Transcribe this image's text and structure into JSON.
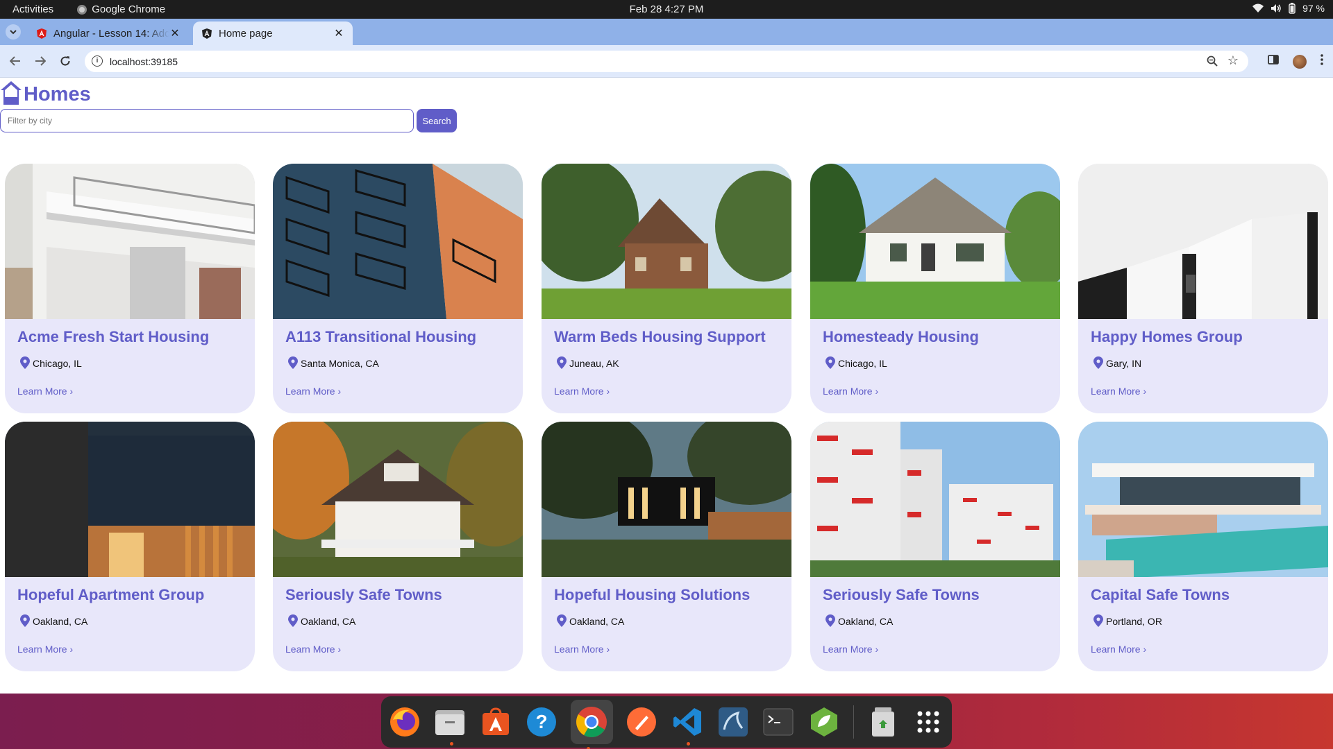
{
  "system_bar": {
    "activities": "Activities",
    "app_name": "Google Chrome",
    "clock": "Feb 28  4:27 PM",
    "battery": "97 %"
  },
  "browser": {
    "tabs": [
      {
        "title": "Angular - Lesson 14: Add",
        "icon": "angular-red-icon"
      },
      {
        "title": "Home page",
        "icon": "angular-dark-icon"
      }
    ],
    "url": "localhost:39185"
  },
  "app": {
    "brand": "Homes",
    "filter_placeholder": "Filter by city",
    "search_label": "Search",
    "learn_more": "Learn More ›",
    "listings": [
      {
        "name": "Acme Fresh Start Housing",
        "location": "Chicago, IL"
      },
      {
        "name": "A113 Transitional Housing",
        "location": "Santa Monica, CA"
      },
      {
        "name": "Warm Beds Housing Support",
        "location": "Juneau, AK"
      },
      {
        "name": "Homesteady Housing",
        "location": "Chicago, IL"
      },
      {
        "name": "Happy Homes Group",
        "location": "Gary, IN"
      },
      {
        "name": "Hopeful Apartment Group",
        "location": "Oakland, CA"
      },
      {
        "name": "Seriously Safe Towns",
        "location": "Oakland, CA"
      },
      {
        "name": "Hopeful Housing Solutions",
        "location": "Oakland, CA"
      },
      {
        "name": "Seriously Safe Towns",
        "location": "Oakland, CA"
      },
      {
        "name": "Capital Safe Towns",
        "location": "Portland, OR"
      }
    ]
  },
  "dock": [
    "firefox-icon",
    "files-icon",
    "app-center-icon",
    "help-icon",
    "chrome-icon",
    "postman-icon",
    "vscode-icon",
    "mysql-workbench-icon",
    "terminal-icon",
    "spring-tools-icon",
    "trash-icon",
    "app-grid-icon"
  ],
  "colors": {
    "accent": "#605dc8",
    "card_bg": "#e8e7fa"
  }
}
